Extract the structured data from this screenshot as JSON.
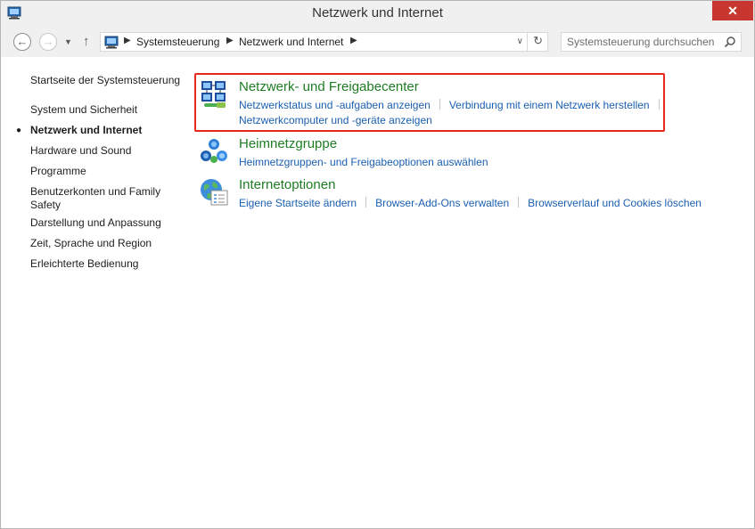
{
  "window": {
    "title": "Netzwerk und Internet",
    "close_glyph": "✕"
  },
  "nav": {
    "back_glyph": "←",
    "forward_glyph": "→",
    "recent_glyph": "▼",
    "up_glyph": "↑",
    "breadcrumbs": [
      "Systemsteuerung",
      "Netzwerk und Internet"
    ],
    "separator": "▶",
    "dropdown_glyph": "∨",
    "refresh_glyph": "↻",
    "search_placeholder": "Systemsteuerung durchsuchen"
  },
  "sidebar": {
    "home": "Startseite der Systemsteuerung",
    "items": [
      {
        "label": "System und Sicherheit",
        "active": false
      },
      {
        "label": "Netzwerk und Internet",
        "active": true
      },
      {
        "label": "Hardware und Sound",
        "active": false
      },
      {
        "label": "Programme",
        "active": false
      },
      {
        "label": "Benutzerkonten und Family Safety",
        "active": false
      },
      {
        "label": "Darstellung und Anpassung",
        "active": false
      },
      {
        "label": "Zeit, Sprache und Region",
        "active": false
      },
      {
        "label": "Erleichterte Bedienung",
        "active": false
      }
    ],
    "bullet": "●"
  },
  "categories": [
    {
      "title": "Netzwerk- und Freigabecenter",
      "icon": "network-sharing-center-icon",
      "links": [
        "Netzwerkstatus und -aufgaben anzeigen",
        "Verbindung mit einem Netzwerk herstellen",
        "Netzwerkcomputer und -geräte anzeigen"
      ]
    },
    {
      "title": "Heimnetzgruppe",
      "icon": "homegroup-icon",
      "links": [
        "Heimnetzgruppen- und Freigabeoptionen auswählen"
      ]
    },
    {
      "title": "Internetoptionen",
      "icon": "internet-options-icon",
      "links": [
        "Eigene Startseite ändern",
        "Browser-Add-Ons verwalten",
        "Browserverlauf und Cookies löschen"
      ]
    }
  ],
  "colors": {
    "category_title": "#1e7d24",
    "link": "#1b5fb0",
    "highlight_border": "#e8281c",
    "close_button": "#c7372f"
  }
}
